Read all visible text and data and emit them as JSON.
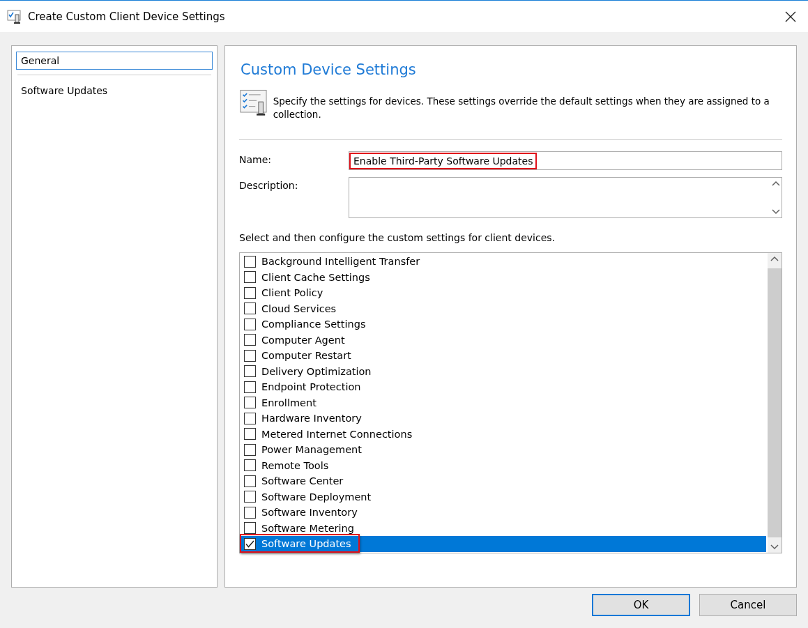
{
  "window": {
    "title": "Create Custom Client Device Settings"
  },
  "sidebar": {
    "items": [
      {
        "label": "General",
        "selected": true
      },
      {
        "label": "Software Updates",
        "selected": false
      }
    ]
  },
  "page": {
    "heading": "Custom Device Settings",
    "intro": "Specify the settings for devices. These settings override the default settings when they are assigned to a collection.",
    "name_field": {
      "label": "Name:",
      "value": "Enable Third-Party Software Updates",
      "highlighted": true
    },
    "description_field": {
      "label": "Description:"
    },
    "list_caption": "Select and then configure the custom settings for client devices.",
    "settings": [
      {
        "label": "Background Intelligent Transfer",
        "checked": false,
        "selected": false,
        "highlighted": false
      },
      {
        "label": "Client Cache Settings",
        "checked": false,
        "selected": false,
        "highlighted": false
      },
      {
        "label": "Client Policy",
        "checked": false,
        "selected": false,
        "highlighted": false
      },
      {
        "label": "Cloud Services",
        "checked": false,
        "selected": false,
        "highlighted": false
      },
      {
        "label": "Compliance Settings",
        "checked": false,
        "selected": false,
        "highlighted": false
      },
      {
        "label": "Computer Agent",
        "checked": false,
        "selected": false,
        "highlighted": false
      },
      {
        "label": "Computer Restart",
        "checked": false,
        "selected": false,
        "highlighted": false
      },
      {
        "label": "Delivery Optimization",
        "checked": false,
        "selected": false,
        "highlighted": false
      },
      {
        "label": "Endpoint Protection",
        "checked": false,
        "selected": false,
        "highlighted": false
      },
      {
        "label": "Enrollment",
        "checked": false,
        "selected": false,
        "highlighted": false
      },
      {
        "label": "Hardware Inventory",
        "checked": false,
        "selected": false,
        "highlighted": false
      },
      {
        "label": "Metered Internet Connections",
        "checked": false,
        "selected": false,
        "highlighted": false
      },
      {
        "label": "Power Management",
        "checked": false,
        "selected": false,
        "highlighted": false
      },
      {
        "label": "Remote Tools",
        "checked": false,
        "selected": false,
        "highlighted": false
      },
      {
        "label": "Software Center",
        "checked": false,
        "selected": false,
        "highlighted": false
      },
      {
        "label": "Software Deployment",
        "checked": false,
        "selected": false,
        "highlighted": false
      },
      {
        "label": "Software Inventory",
        "checked": false,
        "selected": false,
        "highlighted": false
      },
      {
        "label": "Software Metering",
        "checked": false,
        "selected": false,
        "highlighted": false
      },
      {
        "label": "Software Updates",
        "checked": true,
        "selected": true,
        "highlighted": true
      }
    ]
  },
  "buttons": [
    {
      "label": "OK",
      "default": true
    },
    {
      "label": "Cancel",
      "default": false
    }
  ]
}
